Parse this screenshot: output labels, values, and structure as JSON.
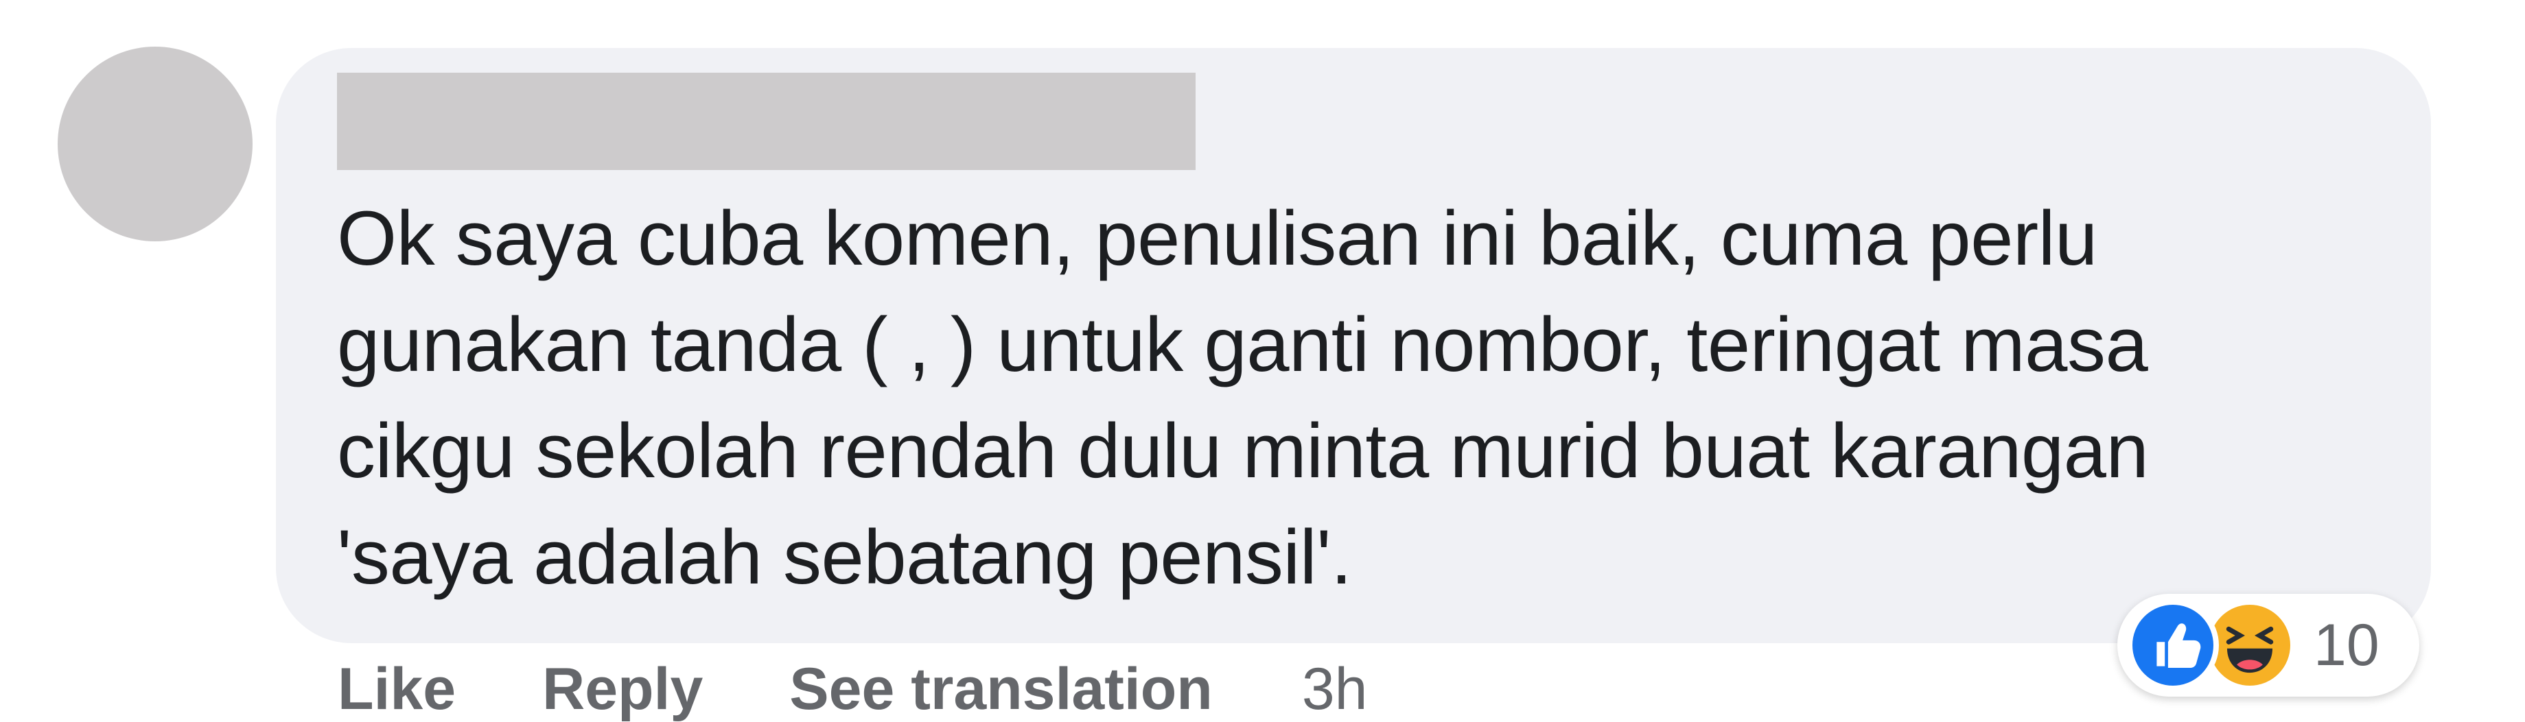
{
  "comment": {
    "text": "Ok saya cuba komen, penulisan ini baik, cuma perlu\ngunakan tanda ( , ) untuk ganti nombor, teringat masa\ncikgu sekolah rendah dulu minta murid buat karangan\n'saya adalah sebatang pensil'."
  },
  "actions": {
    "like_label": "Like",
    "reply_label": "Reply",
    "translate_label": "See translation",
    "time": "3h"
  },
  "reactions": {
    "icons": [
      "like-icon",
      "haha-icon"
    ],
    "count": "10"
  },
  "colors": {
    "bubble": "#f0f1f5",
    "redacted": "#cdcbcc",
    "text": "#1c1e21",
    "secondary_text": "#65676b",
    "like_blue": "#1877f2",
    "haha_yellow": "#f7b125"
  }
}
